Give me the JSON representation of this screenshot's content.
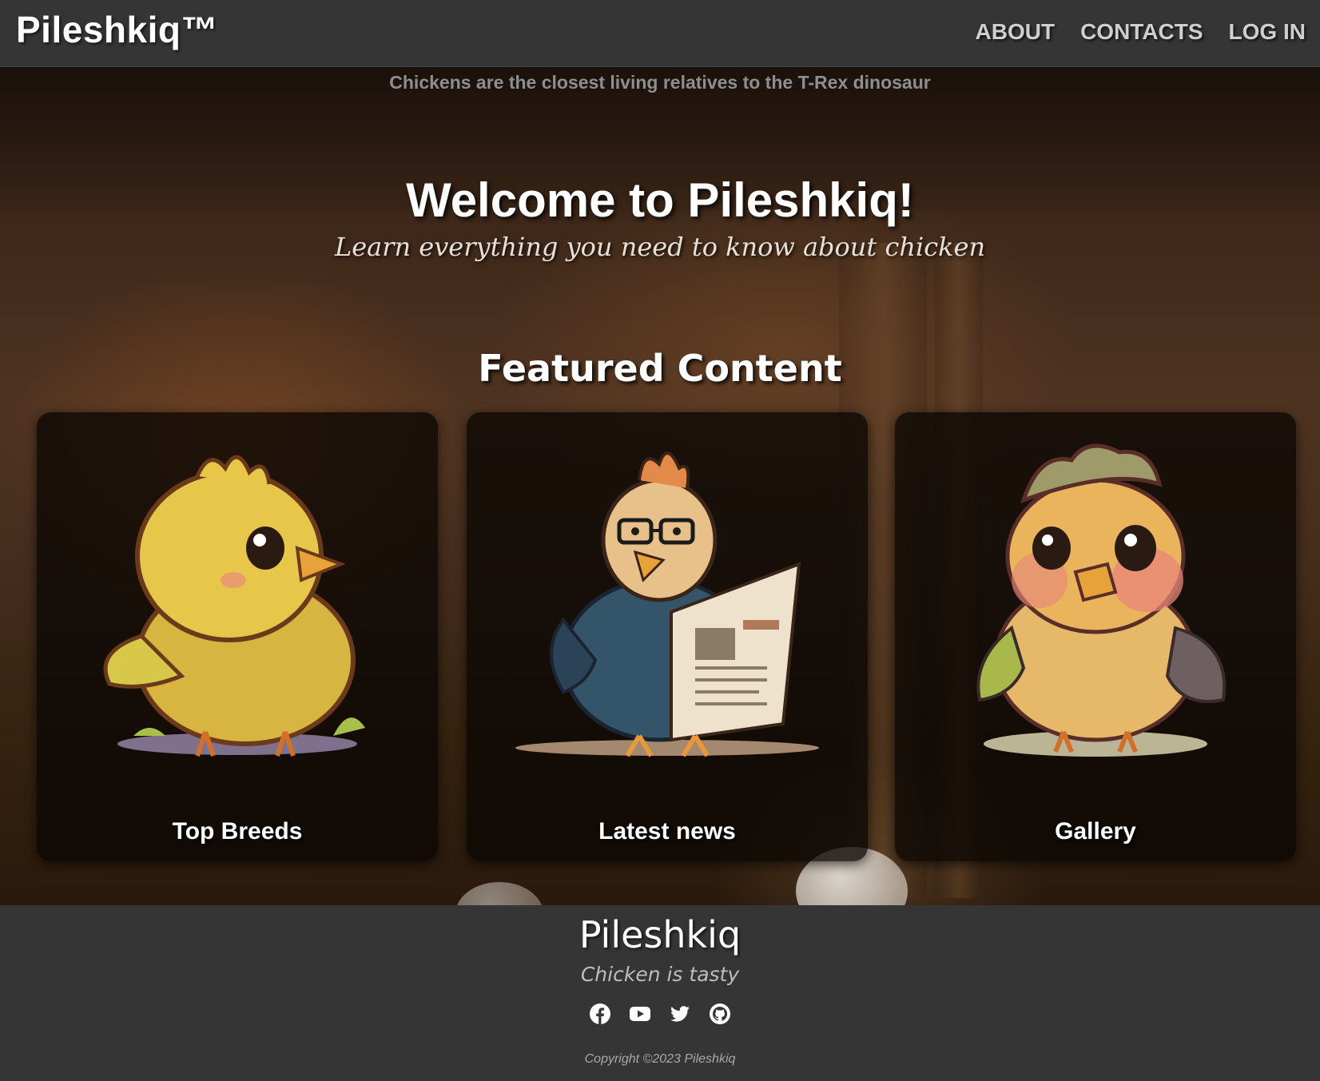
{
  "header": {
    "brand": "Pileshkiq™",
    "nav": [
      "ABOUT",
      "CONTACTS",
      "LOG IN"
    ]
  },
  "hero": {
    "fact": "Chickens are the closest living relatives to the T-Rex dinosaur",
    "title": "Welcome to Pileshkiq!",
    "tagline": "Learn everything you need to know about chicken",
    "featured_title": "Featured Content"
  },
  "cards": [
    {
      "label": "Top Breeds",
      "icon": "yellow-chick-icon"
    },
    {
      "label": "Latest news",
      "icon": "chicken-reading-newspaper-icon"
    },
    {
      "label": "Gallery",
      "icon": "colorful-chick-icon"
    }
  ],
  "footer": {
    "brand": "Pileshkiq",
    "tagline": "Chicken is tasty",
    "socials": [
      "facebook-icon",
      "youtube-icon",
      "twitter-icon",
      "github-icon"
    ],
    "copyright": "Copyright ©2023 Pileshkiq"
  },
  "colors": {
    "header_bg": "#353535",
    "footer_bg": "#353535",
    "card_bg": "#0a0604",
    "nav_text": "#cfcfcf"
  }
}
